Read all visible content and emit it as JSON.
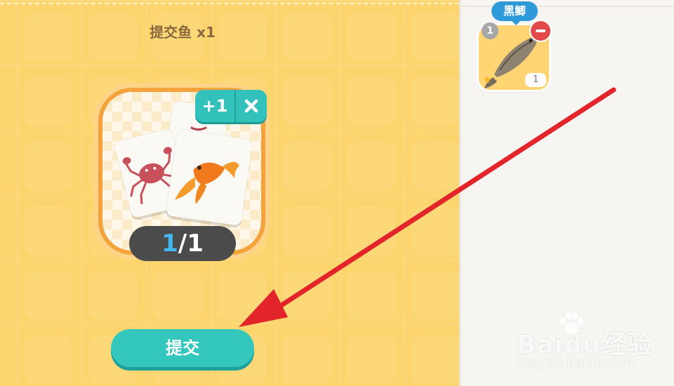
{
  "quest": {
    "title": "提交鱼 x1",
    "progress_current": "1",
    "progress_total": "/1",
    "add_label": "+1",
    "submit_label": "提交"
  },
  "inventory": {
    "item_name": "黑鲫",
    "level": "1",
    "count": "1"
  },
  "watermark": {
    "main": "Baidu经验",
    "sub": "jingyan.baidu.com"
  },
  "colors": {
    "panel_yellow": "#fcd56e",
    "card_border": "#f4a33c",
    "teal": "#33c1bb",
    "pill_dark": "#4b4b4b",
    "progress_blue": "#45b7f0",
    "label_blue": "#2f9ad9",
    "remove_red": "#e24a4a",
    "annotation_red": "#e3242b"
  },
  "icons": [
    "close-icon",
    "crab-icon",
    "goldfish-icon",
    "carp-icon",
    "star-icon",
    "minus-icon",
    "paw-icon"
  ]
}
